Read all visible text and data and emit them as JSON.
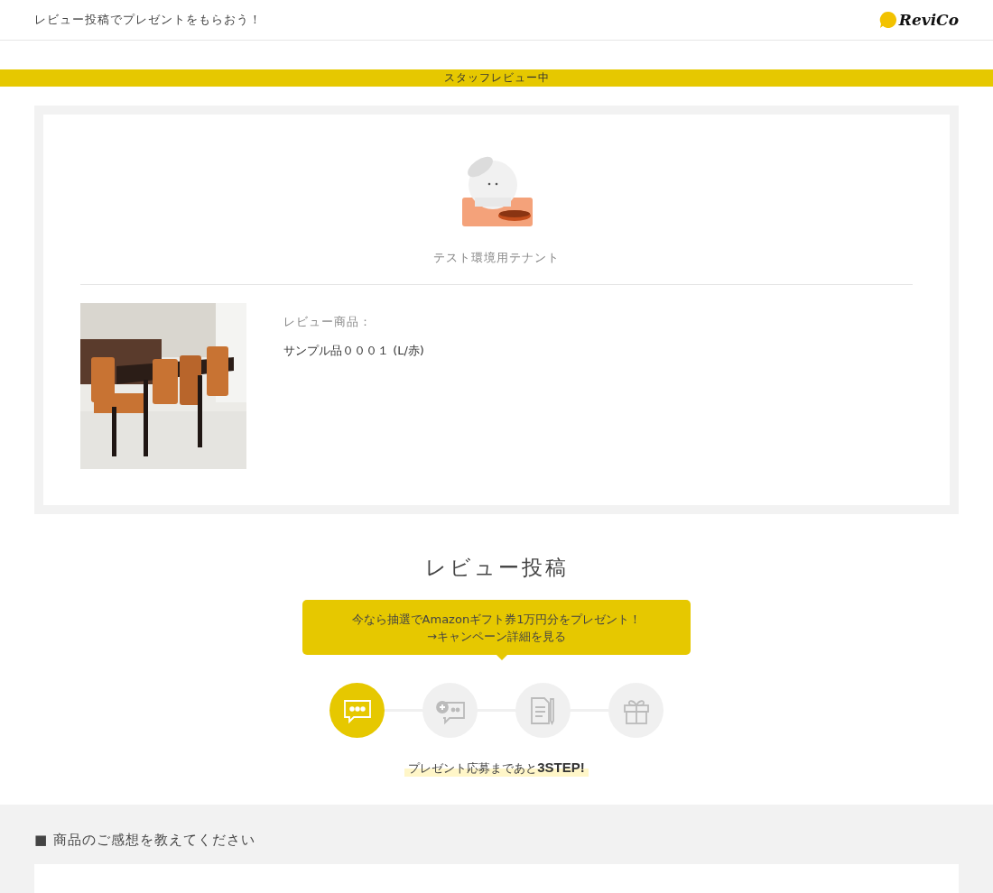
{
  "header": {
    "title": "レビュー投稿でプレゼントをもらおう！",
    "logo": "ReviCo"
  },
  "status_banner": "スタッフレビュー中",
  "shop": {
    "tenant_name": "テスト環境用テナント",
    "product_label": "レビュー商品：",
    "product_name": "サンプル品０００１ (L/赤)"
  },
  "review": {
    "title": "レビュー投稿",
    "campaign": [
      "今なら抽選でAmazonギフト券1万円分をプレゼント！",
      "→キャンペーン詳細を見る"
    ],
    "steps": [
      {
        "kind": "comment",
        "selected": true
      },
      {
        "kind": "add-comment",
        "selected": false
      },
      {
        "kind": "form",
        "selected": false
      },
      {
        "kind": "gift",
        "selected": false
      }
    ],
    "remaining": "プレゼント応募まであと**3STEP!**"
  },
  "question": {
    "heading": "■ 商品のご感想を教えてください"
  }
}
